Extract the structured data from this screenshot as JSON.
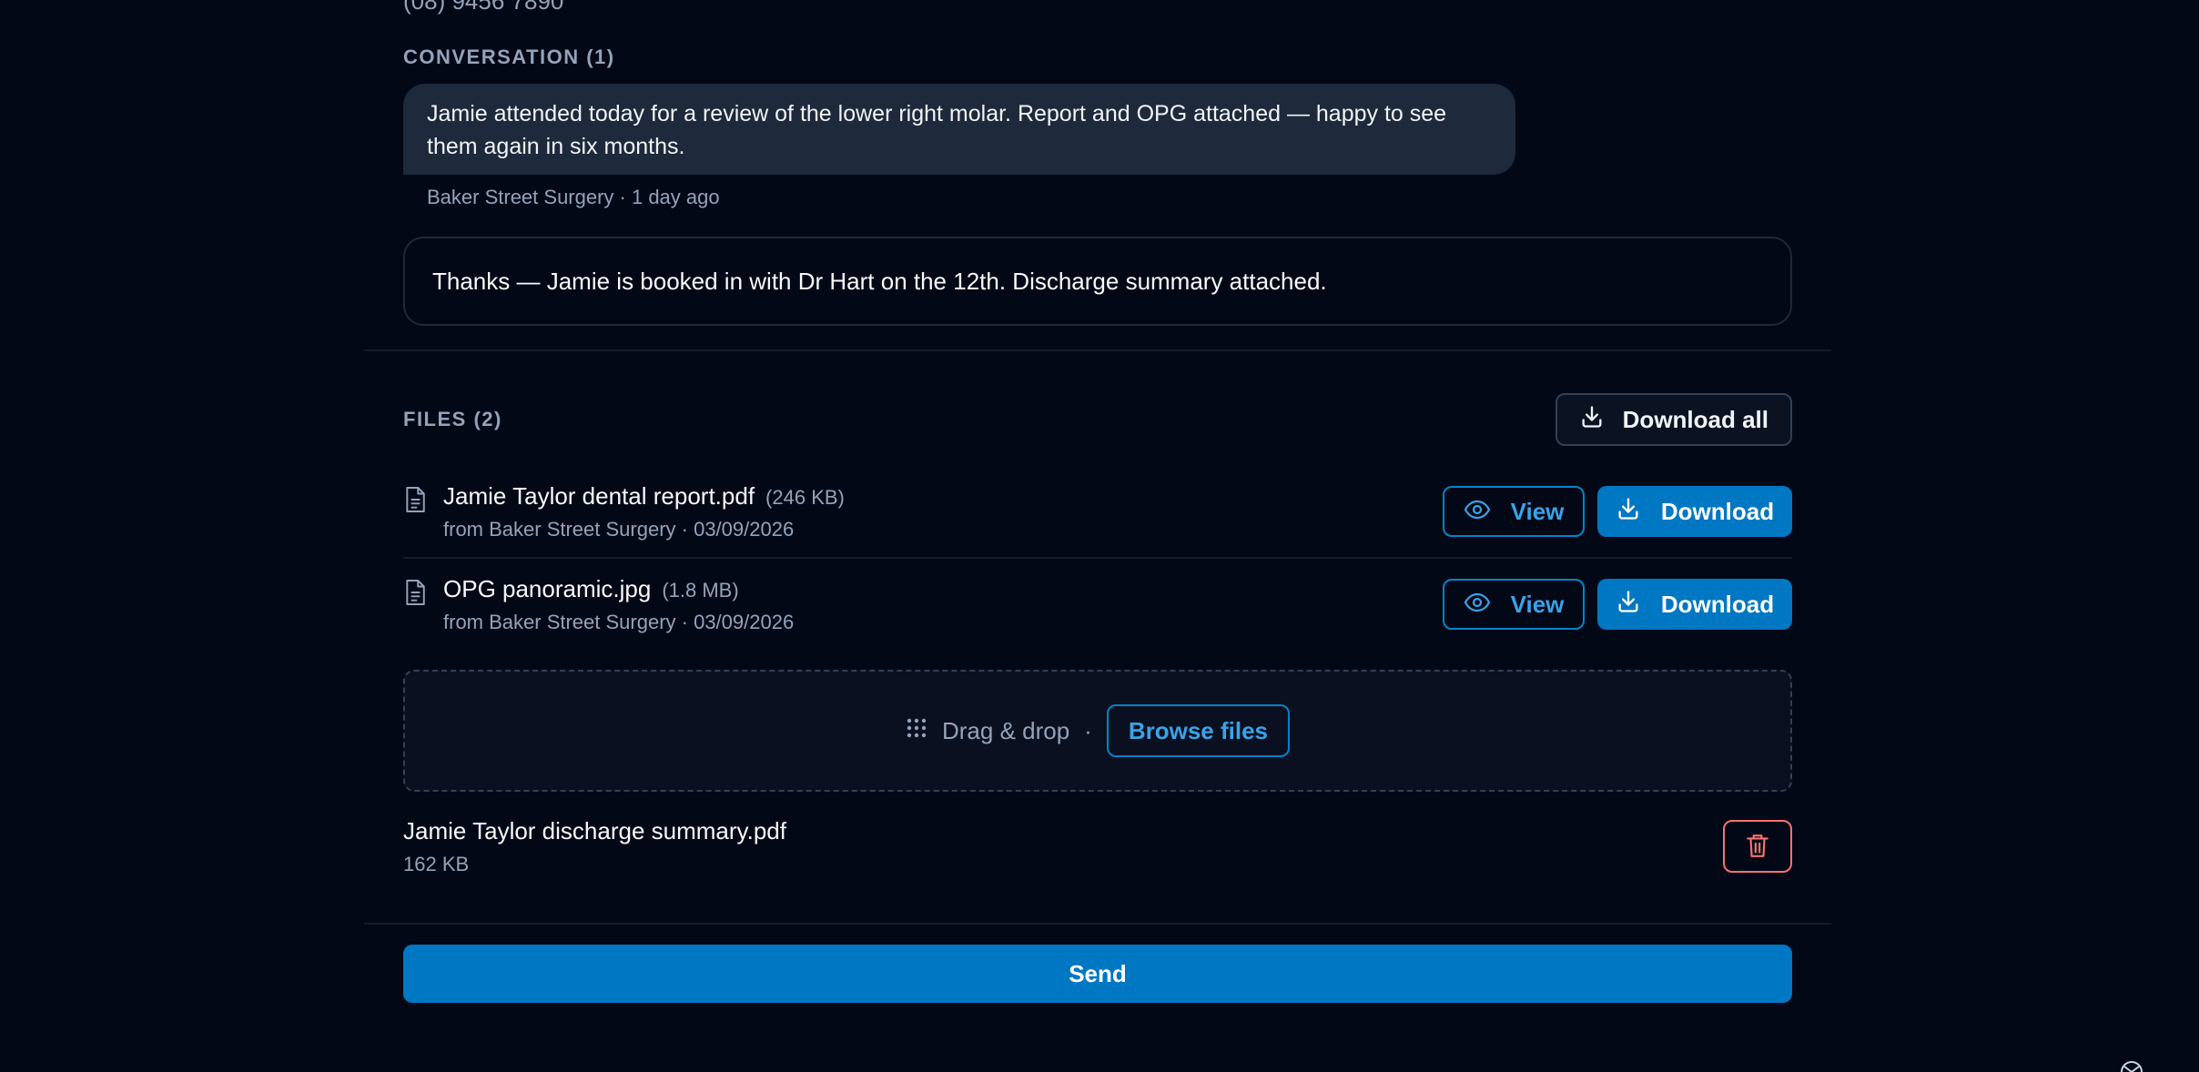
{
  "contact": {
    "phone": "(08) 9456 7890"
  },
  "conversation": {
    "title": "CONVERSATION (1)",
    "message": {
      "text": "Jamie attended today for a review of the lower right molar. Report and OPG attached — happy to see them again in six months.",
      "meta": "Baker Street Surgery · 1 day ago"
    },
    "reply_text": "Thanks — Jamie is booked in with Dr Hart on the 12th. Discharge summary attached."
  },
  "files": {
    "title": "FILES (2)",
    "download_all_label": "Download all",
    "items": [
      {
        "name": "Jamie Taylor dental report.pdf",
        "size": "(246 KB)",
        "source": "from Baker Street Surgery · 03/09/2026",
        "view_label": "View",
        "download_label": "Download"
      },
      {
        "name": "OPG panoramic.jpg",
        "size": "(1.8 MB)",
        "source": "from Baker Street Surgery · 03/09/2026",
        "view_label": "View",
        "download_label": "Download"
      }
    ]
  },
  "upload": {
    "drag_label": "Drag & drop",
    "separator": "·",
    "browse_label": "Browse files",
    "pending_file": {
      "name": "Jamie Taylor discharge summary.pdf",
      "size": "162 KB"
    }
  },
  "send_label": "Send",
  "colors": {
    "background": "#030817",
    "accent": "#0077c2",
    "accent_outline": "#0284c7",
    "danger": "#f87171",
    "muted_text": "#94a3b8"
  }
}
